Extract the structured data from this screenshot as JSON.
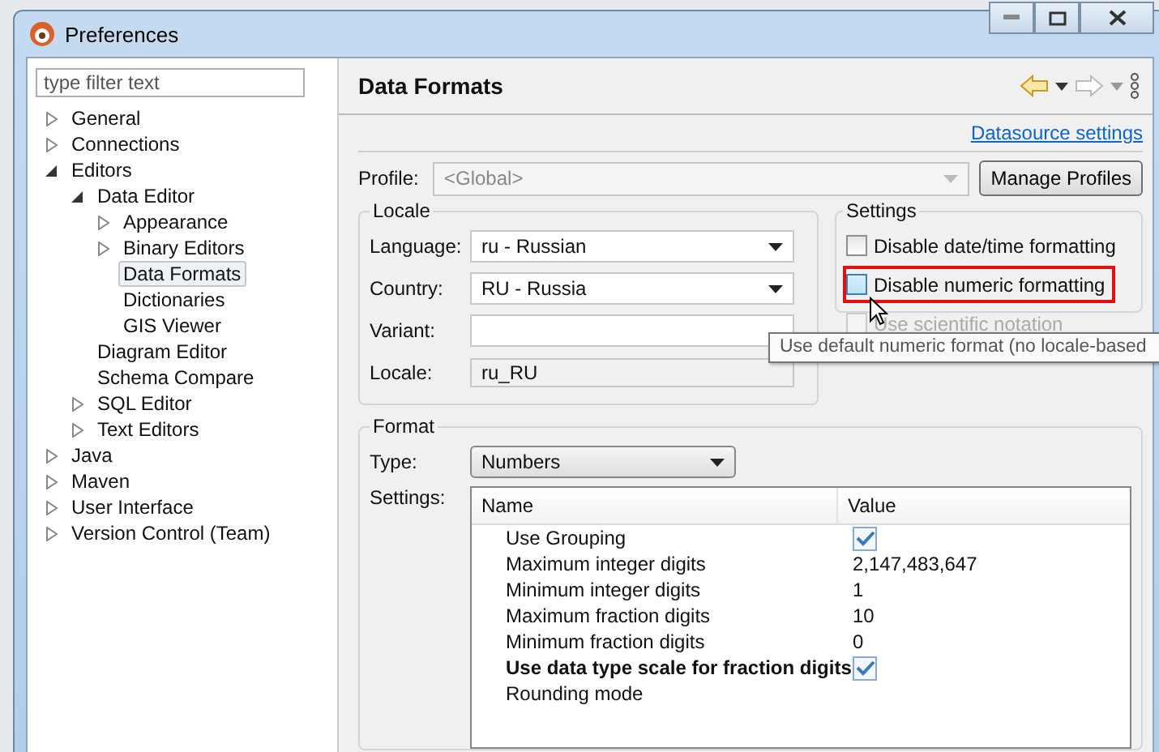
{
  "window": {
    "title": "Preferences"
  },
  "filter": {
    "placeholder": "type filter text"
  },
  "tree": [
    {
      "label": "General",
      "expanded": false,
      "selected": false
    },
    {
      "label": "Connections",
      "expanded": false,
      "selected": false
    },
    {
      "label": "Editors",
      "expanded": true,
      "selected": false,
      "children": [
        {
          "label": "Data Editor",
          "expanded": true,
          "selected": false,
          "children": [
            {
              "label": "Appearance",
              "expanded": false,
              "selected": false
            },
            {
              "label": "Binary Editors",
              "expanded": false,
              "selected": false
            },
            {
              "label": "Data Formats",
              "selected": true
            },
            {
              "label": "Dictionaries",
              "selected": false
            },
            {
              "label": "GIS Viewer",
              "selected": false
            }
          ]
        },
        {
          "label": "Diagram Editor",
          "selected": false
        },
        {
          "label": "Schema Compare",
          "selected": false
        },
        {
          "label": "SQL Editor",
          "expanded": false,
          "selected": false
        },
        {
          "label": "Text Editors",
          "expanded": false,
          "selected": false
        }
      ]
    },
    {
      "label": "Java",
      "expanded": false,
      "selected": false
    },
    {
      "label": "Maven",
      "expanded": false,
      "selected": false
    },
    {
      "label": "User Interface",
      "expanded": false,
      "selected": false
    },
    {
      "label": "Version Control (Team)",
      "expanded": false,
      "selected": false
    }
  ],
  "page": {
    "title": "Data Formats",
    "link": "Datasource settings"
  },
  "profile": {
    "label": "Profile:",
    "value": "<Global>",
    "button": "Manage Profiles"
  },
  "locale": {
    "title": "Locale",
    "fields": [
      {
        "label": "Language:",
        "value": "ru - Russian",
        "kind": "dropdown"
      },
      {
        "label": "Country:",
        "value": "RU - Russia",
        "kind": "dropdown"
      },
      {
        "label": "Variant:",
        "kind": "input"
      },
      {
        "label": "Locale:",
        "value": "ru_RU",
        "kind": "readonly"
      }
    ]
  },
  "settings": {
    "title": "Settings",
    "options": [
      {
        "label": "Disable date/time formatting",
        "checked": false,
        "disabled": false,
        "highlighted": false
      },
      {
        "label": "Disable numeric formatting",
        "checked": false,
        "disabled": false,
        "highlighted": true
      },
      {
        "label": "Use scientific notation",
        "checked": false,
        "disabled": true,
        "highlighted": false
      }
    ]
  },
  "tooltip": "Use default numeric format (no locale-based",
  "format": {
    "title": "Format",
    "type_label": "Type:",
    "type_value": "Numbers",
    "settings_label": "Settings:",
    "columns": [
      "Name",
      "Value"
    ],
    "rows": [
      {
        "name": "Use Grouping",
        "kind": "check",
        "checked": true,
        "bold": false
      },
      {
        "name": "Maximum integer digits",
        "kind": "text",
        "value": "2,147,483,647",
        "bold": false
      },
      {
        "name": "Minimum integer digits",
        "kind": "text",
        "value": "1",
        "bold": false
      },
      {
        "name": "Maximum fraction digits",
        "kind": "text",
        "value": "10",
        "bold": false
      },
      {
        "name": "Minimum fraction digits",
        "kind": "text",
        "value": "0",
        "bold": false
      },
      {
        "name": "Use data type scale for fraction digits",
        "kind": "check",
        "checked": true,
        "bold": true
      },
      {
        "name": "Rounding mode",
        "kind": "empty",
        "bold": false
      }
    ]
  }
}
